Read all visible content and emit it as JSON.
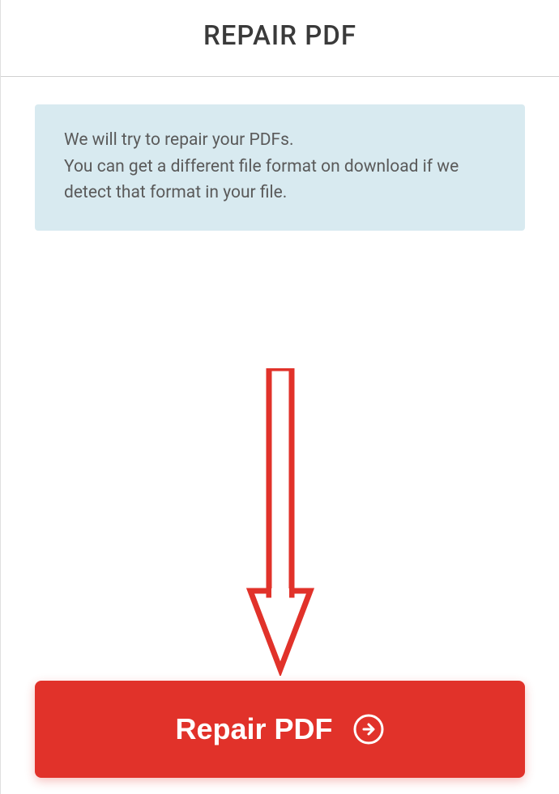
{
  "header": {
    "title": "REPAIR PDF"
  },
  "info": {
    "line1": "We will try to repair your PDFs.",
    "line2": "You can get a different file format on download if we detect that format in your file."
  },
  "button": {
    "label": "Repair PDF"
  },
  "colors": {
    "primary": "#e1322a",
    "info_bg": "#d8eaf0"
  }
}
